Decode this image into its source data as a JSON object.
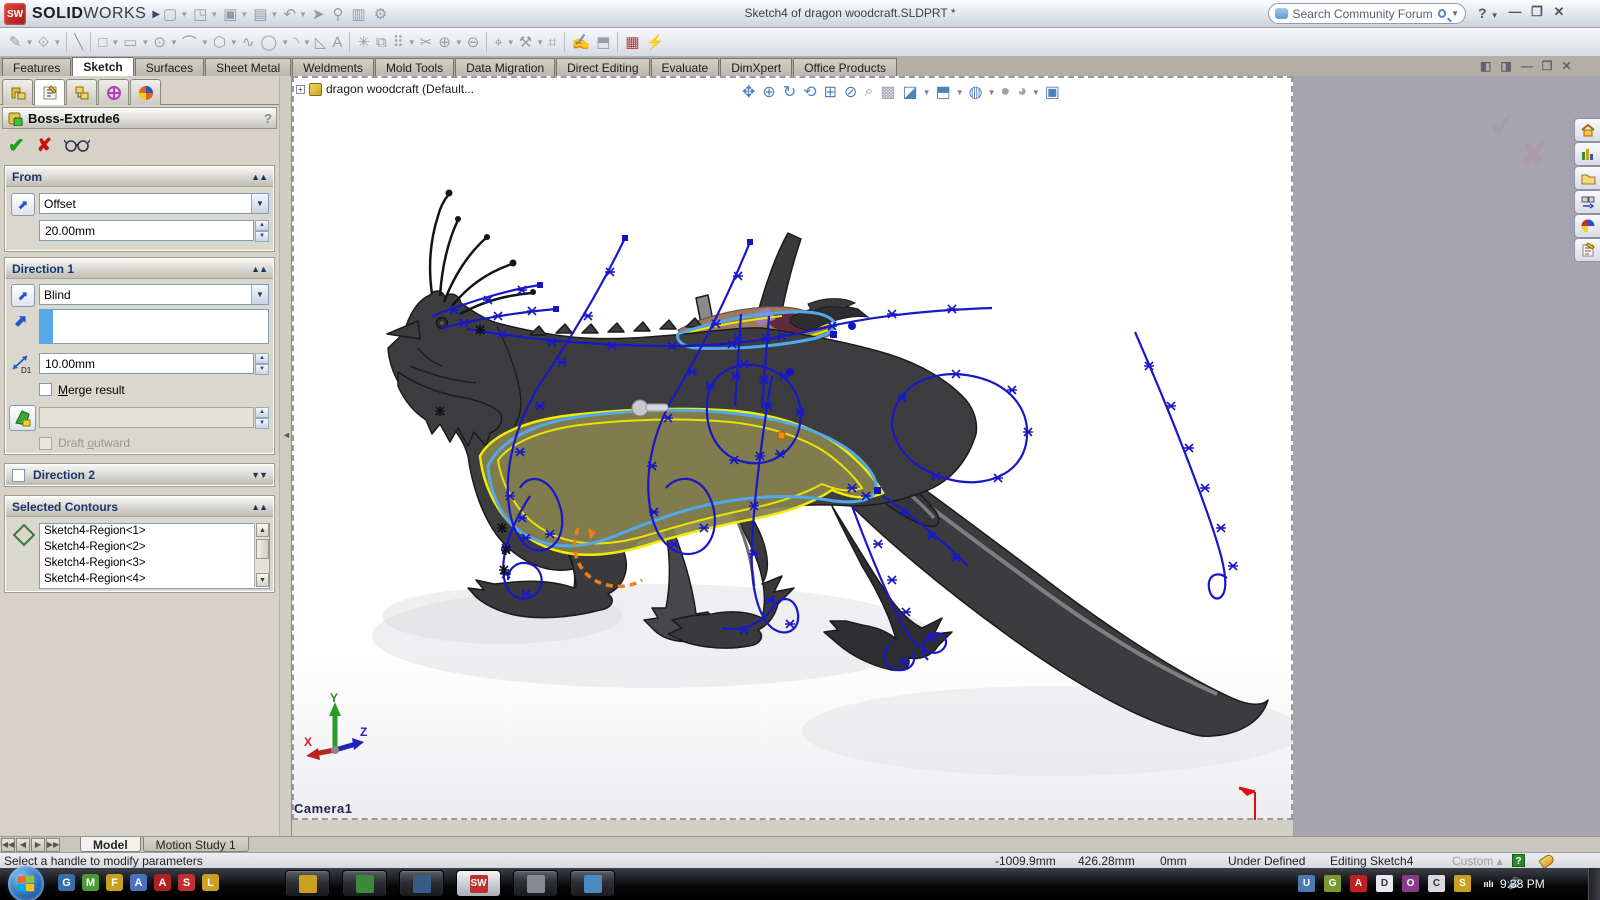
{
  "titlebar": {
    "brand_sw": "SW",
    "brand_solid": "SOLID",
    "brand_works": "WORKS",
    "title": "Sketch4 of dragon woodcraft.SLDPRT *",
    "search_placeholder": "Search Community Forum",
    "help": "?"
  },
  "std_toolbar_icons": [
    "new-icon",
    "open-icon",
    "save-icon",
    "print-icon",
    "undo-icon",
    "select-icon",
    "pin-icon",
    "book-icon",
    "options-icon"
  ],
  "sketch_toolbar_icons": [
    "sketch-icon",
    "smart-dimension-icon",
    "line-icon",
    "rectangle-icon",
    "slot-icon",
    "circle-icon",
    "arc-icon",
    "polygon-icon",
    "spline-icon",
    "ellipse-icon",
    "fillet-icon",
    "chamfer-icon",
    "text-icon",
    "point-icon",
    "mirror-icon",
    "pattern-icon",
    "trim-icon",
    "convert-icon",
    "offset-icon",
    "display-relations-icon",
    "repair-icon",
    "quick-snaps-icon",
    "rapid-sketch-icon",
    "instant3d-icon",
    "screen-capture-icon",
    "simulation-icon"
  ],
  "cmd_tabs": [
    {
      "label": "Features",
      "active": false
    },
    {
      "label": "Sketch",
      "active": true
    },
    {
      "label": "Surfaces",
      "active": false
    },
    {
      "label": "Sheet Metal",
      "active": false
    },
    {
      "label": "Weldments",
      "active": false
    },
    {
      "label": "Mold Tools",
      "active": false
    },
    {
      "label": "Data Migration",
      "active": false
    },
    {
      "label": "Direct Editing",
      "active": false
    },
    {
      "label": "Evaluate",
      "active": false
    },
    {
      "label": "DimXpert",
      "active": false
    },
    {
      "label": "Office Products",
      "active": false
    }
  ],
  "property_manager": {
    "title": "Boss-Extrude6",
    "help": "?",
    "from_group": {
      "label": "From",
      "condition": "Offset",
      "offset_value": "20.00mm"
    },
    "direction1_group": {
      "label": "Direction 1",
      "condition": "Blind",
      "depth_value": "10.00mm",
      "merge_label": "Merge result",
      "draft_label": "Draft outward"
    },
    "direction2_group": {
      "label": "Direction 2"
    },
    "contours_group": {
      "label": "Selected Contours",
      "items": [
        "Sketch4-Region<1>",
        "Sketch4-Region<2>",
        "Sketch4-Region<3>",
        "Sketch4-Region<4>"
      ]
    }
  },
  "viewport": {
    "tree_label": "dragon woodcraft  (Default...",
    "camera_label": "Camera1",
    "hud_icons": [
      "pan-icon",
      "zoom-fit-icon",
      "rotate-view-icon",
      "previous-view-icon",
      "zoom-area-icon",
      "zoom-inout-icon",
      "magnify-icon",
      "shadow-icon",
      "section-view-icon",
      "view-orientation-icon",
      "display-style-icon",
      "appearance-icon",
      "scene-icon",
      "camera-icon"
    ]
  },
  "model_tabs": {
    "tabs": [
      {
        "label": "Model",
        "active": true
      },
      {
        "label": "Motion Study 1",
        "active": false
      }
    ]
  },
  "statusbar": {
    "message": "Select a handle to modify parameters",
    "x": "-1009.9mm",
    "y": "426.28mm",
    "z": "0mm",
    "constraint": "Under Defined",
    "mode": "Editing Sketch4",
    "units": "Custom"
  },
  "taskbar": {
    "clock": "9:38 PM",
    "quick_launch": [
      "globe-icon",
      "msn-icon",
      "fish-icon",
      "autocad-icon",
      "acrobat-icon",
      "solidworks-icon",
      "lightning-icon"
    ],
    "apps": [
      {
        "name": "flash-app",
        "active": false
      },
      {
        "name": "terrain-app",
        "active": false
      },
      {
        "name": "network-app",
        "active": false
      },
      {
        "name": "solidworks-app",
        "active": true
      },
      {
        "name": "gray-app",
        "active": false
      },
      {
        "name": "photos-app",
        "active": false
      }
    ],
    "tray": [
      "user-icon",
      "grid-icon",
      "avira-icon",
      "disc-icon",
      "onenote-icon",
      "clipboard-icon",
      "security-icon",
      "network-signal-icon",
      "volume-icon"
    ]
  },
  "taskpane_icons": [
    "home-icon",
    "resources-icon",
    "folder-icon",
    "design-library-icon",
    "web-icon",
    "document-icon"
  ]
}
